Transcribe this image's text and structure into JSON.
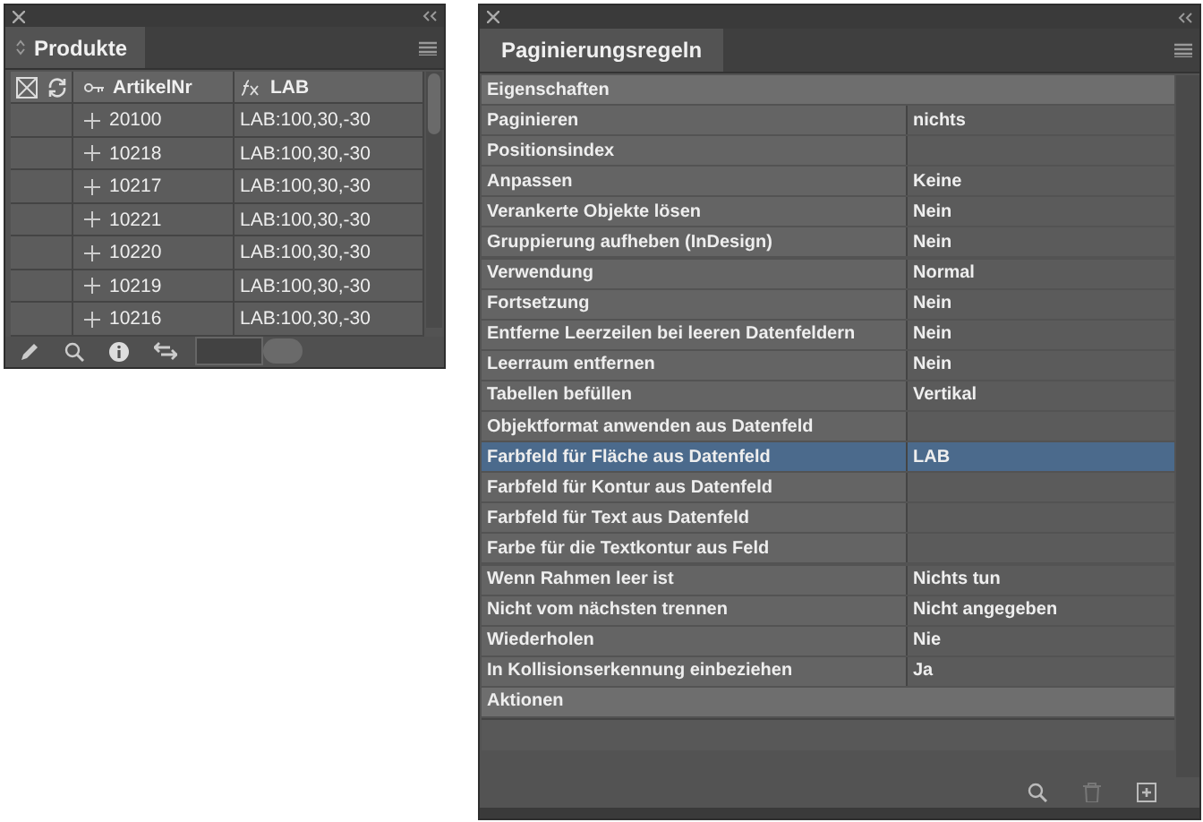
{
  "products_panel": {
    "title": "Produkte",
    "columns": [
      {
        "kind": "icons"
      },
      {
        "kind": "key",
        "label": "ArtikelNr"
      },
      {
        "kind": "formula",
        "label": "LAB"
      }
    ],
    "rows": [
      {
        "artikelnr": "20100",
        "lab": "LAB:100,30,-30"
      },
      {
        "artikelnr": "10218",
        "lab": "LAB:100,30,-30"
      },
      {
        "artikelnr": "10217",
        "lab": "LAB:100,30,-30"
      },
      {
        "artikelnr": "10221",
        "lab": "LAB:100,30,-30"
      },
      {
        "artikelnr": "10220",
        "lab": "LAB:100,30,-30"
      },
      {
        "artikelnr": "10219",
        "lab": "LAB:100,30,-30"
      },
      {
        "artikelnr": "10216",
        "lab": "LAB:100,30,-30"
      }
    ]
  },
  "pagination_panel": {
    "title": "Paginierungsregeln",
    "items": [
      {
        "kind": "group",
        "label": "Eigenschaften"
      },
      {
        "kind": "property",
        "label": "Paginieren",
        "value": "nichts",
        "selected": false
      },
      {
        "kind": "property",
        "label": "Positionsindex",
        "selected": false
      },
      {
        "kind": "property",
        "label": "Anpassen",
        "value": "Keine",
        "selected": false
      },
      {
        "kind": "property",
        "label": "Verankerte Objekte lösen",
        "value": "Nein",
        "selected": false
      },
      {
        "kind": "property",
        "label": "Gruppierung aufheben (InDesign)",
        "value": "Nein",
        "selected": false
      },
      {
        "kind": "property",
        "label": "Verwendung",
        "value": "Normal",
        "selected": false
      },
      {
        "kind": "property",
        "label": "Fortsetzung",
        "value": "Nein",
        "selected": false
      },
      {
        "kind": "property",
        "label": "Entferne Leerzeilen bei leeren Datenfeldern",
        "value": "Nein",
        "selected": false
      },
      {
        "kind": "property",
        "label": "Leerraum entfernen",
        "value": "Nein",
        "selected": false
      },
      {
        "kind": "property",
        "label": "Tabellen befüllen",
        "value": "Vertikal",
        "selected": false
      },
      {
        "kind": "property",
        "label": "Objektformat anwenden aus Datenfeld",
        "selected": false
      },
      {
        "kind": "property",
        "label": "Farbfeld für Fläche aus Datenfeld",
        "value": "LAB",
        "selected": true
      },
      {
        "kind": "property",
        "label": "Farbfeld für Kontur aus Datenfeld",
        "selected": false
      },
      {
        "kind": "property",
        "label": "Farbfeld für Text aus Datenfeld",
        "selected": false
      },
      {
        "kind": "property",
        "label": "Farbe für die Textkontur aus Feld",
        "selected": false
      },
      {
        "kind": "property",
        "label": "Wenn Rahmen leer ist",
        "value": "Nichts tun",
        "selected": false
      },
      {
        "kind": "property",
        "label": "Nicht vom nächsten trennen",
        "value": "Nicht angegeben",
        "selected": false
      },
      {
        "kind": "property",
        "label": "Wiederholen",
        "value": "Nie",
        "selected": false
      },
      {
        "kind": "property",
        "label": "In Kollisionserkennung einbeziehen",
        "value": "Ja",
        "selected": false
      },
      {
        "kind": "group",
        "label": "Aktionen"
      }
    ]
  }
}
